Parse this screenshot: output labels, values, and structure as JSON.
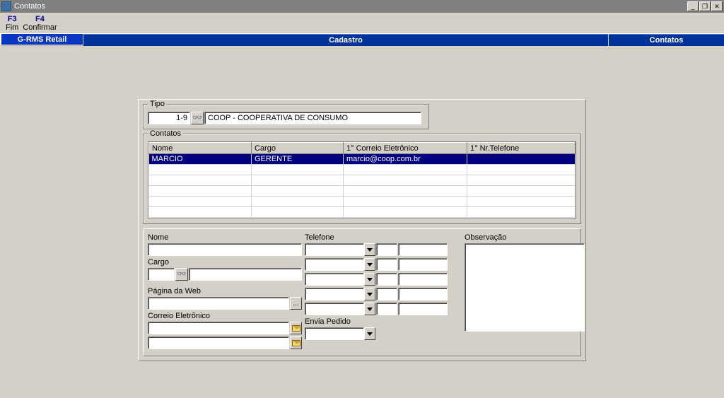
{
  "window": {
    "title": "Contatos",
    "min": "_",
    "max": "❐",
    "close": "✕"
  },
  "menu": {
    "f3": "F3",
    "f4": "F4",
    "fim": "Fim",
    "confirmar": "Confirmar"
  },
  "nav": {
    "left": "G-RMS Retail",
    "center": "Cadastro",
    "right": "Contatos"
  },
  "tipo": {
    "legend": "Tipo",
    "code": "1-9",
    "lookup_glyph": "👓",
    "desc": "COOP - COOPERATIVA DE CONSUMO"
  },
  "contatos_fs": {
    "legend": "Contatos",
    "headers": {
      "nome": "Nome",
      "cargo": "Cargo",
      "email": "1° Correio Eletrônico",
      "tel": "1° Nr.Telefone"
    },
    "rows": [
      {
        "nome": "MARCIO",
        "cargo": "GERENTE",
        "email": "marcio@coop.com.br",
        "tel": ""
      }
    ]
  },
  "detail": {
    "labels": {
      "nome": "Nome",
      "cargo": "Cargo",
      "pagina": "Página da Web",
      "correio": "Correio Eletrônico",
      "telefone": "Telefone",
      "envia": "Envia Pedido",
      "obs": "Observação",
      "ellipsis": "..."
    },
    "values": {
      "nome": "",
      "cargo_code": "",
      "cargo_desc": "",
      "pagina": "",
      "correio1": "",
      "correio2": "",
      "tel_type_1": "",
      "tel_ddd_1": "",
      "tel_num_1": "",
      "tel_type_2": "",
      "tel_ddd_2": "",
      "tel_num_2": "",
      "tel_type_3": "",
      "tel_ddd_3": "",
      "tel_num_3": "",
      "tel_type_4": "",
      "tel_ddd_4": "",
      "tel_num_4": "",
      "tel_type_5": "",
      "tel_ddd_5": "",
      "tel_num_5": "",
      "envia": "",
      "obs": ""
    },
    "lookup_glyph": "👓"
  }
}
